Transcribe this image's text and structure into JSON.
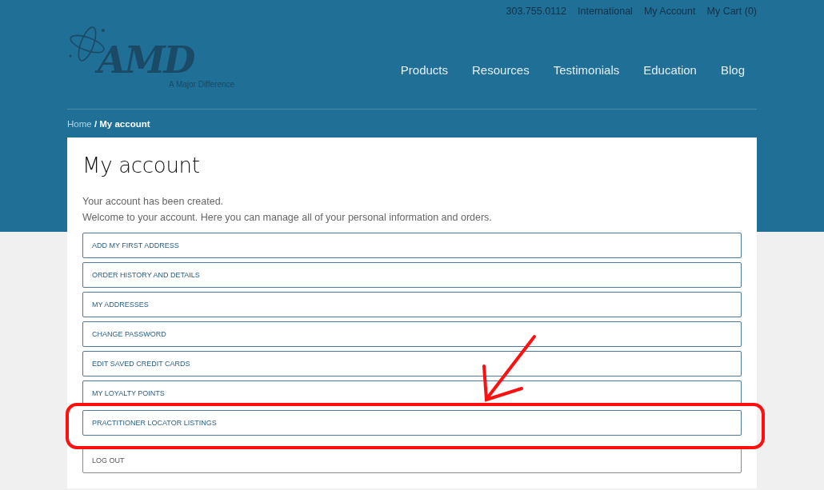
{
  "top_links": [
    "303.755.0112",
    "International",
    "My Account",
    "My Cart (0)"
  ],
  "logo": {
    "wordmark": "AMD",
    "tagline": "A Major Difference"
  },
  "nav": [
    "Products",
    "Resources",
    "Testimonials",
    "Education",
    "Blog"
  ],
  "breadcrumb": {
    "home": "Home",
    "separator": "/",
    "current": "My account"
  },
  "page": {
    "title": "My account",
    "messages": [
      "Your account has been created.",
      "Welcome to your account. Here you can manage all of your personal information and orders."
    ]
  },
  "account_links": [
    {
      "label": "ADD MY FIRST ADDRESS",
      "kind": "link"
    },
    {
      "label": "ORDER HISTORY AND DETAILS",
      "kind": "link"
    },
    {
      "label": "MY ADDRESSES",
      "kind": "link"
    },
    {
      "label": "CHANGE PASSWORD",
      "kind": "link"
    },
    {
      "label": "EDIT SAVED CREDIT CARDS",
      "kind": "link"
    },
    {
      "label": "MY LOYALTY POINTS",
      "kind": "link"
    },
    {
      "label": "PRACTITIONER LOCATOR LISTINGS",
      "kind": "link"
    },
    {
      "label": "LOG OUT",
      "kind": "logout"
    }
  ]
}
